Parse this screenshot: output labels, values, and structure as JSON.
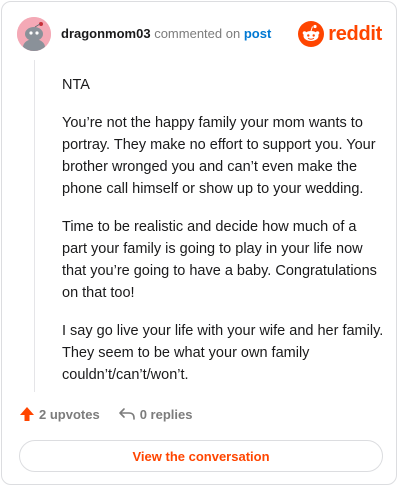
{
  "comment": {
    "username": "dragonmom03",
    "action_text": "commented on",
    "post_link": "post",
    "paragraphs": [
      "NTA",
      "You’re not the happy family your mom wants to portray. They make no effort to support you. Your brother wronged you and can’t even make the phone call himself or show up to your wedding.",
      "Time to be realistic and decide how much of a part your family is going to play in your life now that you’re going to have a baby. Congratulations on that too!",
      "I say go live your life with your wife and her family. They seem to be what your own family couldn’t/can’t/won’t."
    ]
  },
  "brand": {
    "name": "reddit",
    "color": "#ff4500"
  },
  "footer": {
    "upvotes": "2 upvotes",
    "replies": "0 replies",
    "cta": "View the conversation"
  },
  "icons": {
    "avatar": "snoo-avatar-icon",
    "logo": "reddit-alien-icon",
    "upvote": "upvote-arrow-icon",
    "reply": "reply-arrow-icon"
  }
}
